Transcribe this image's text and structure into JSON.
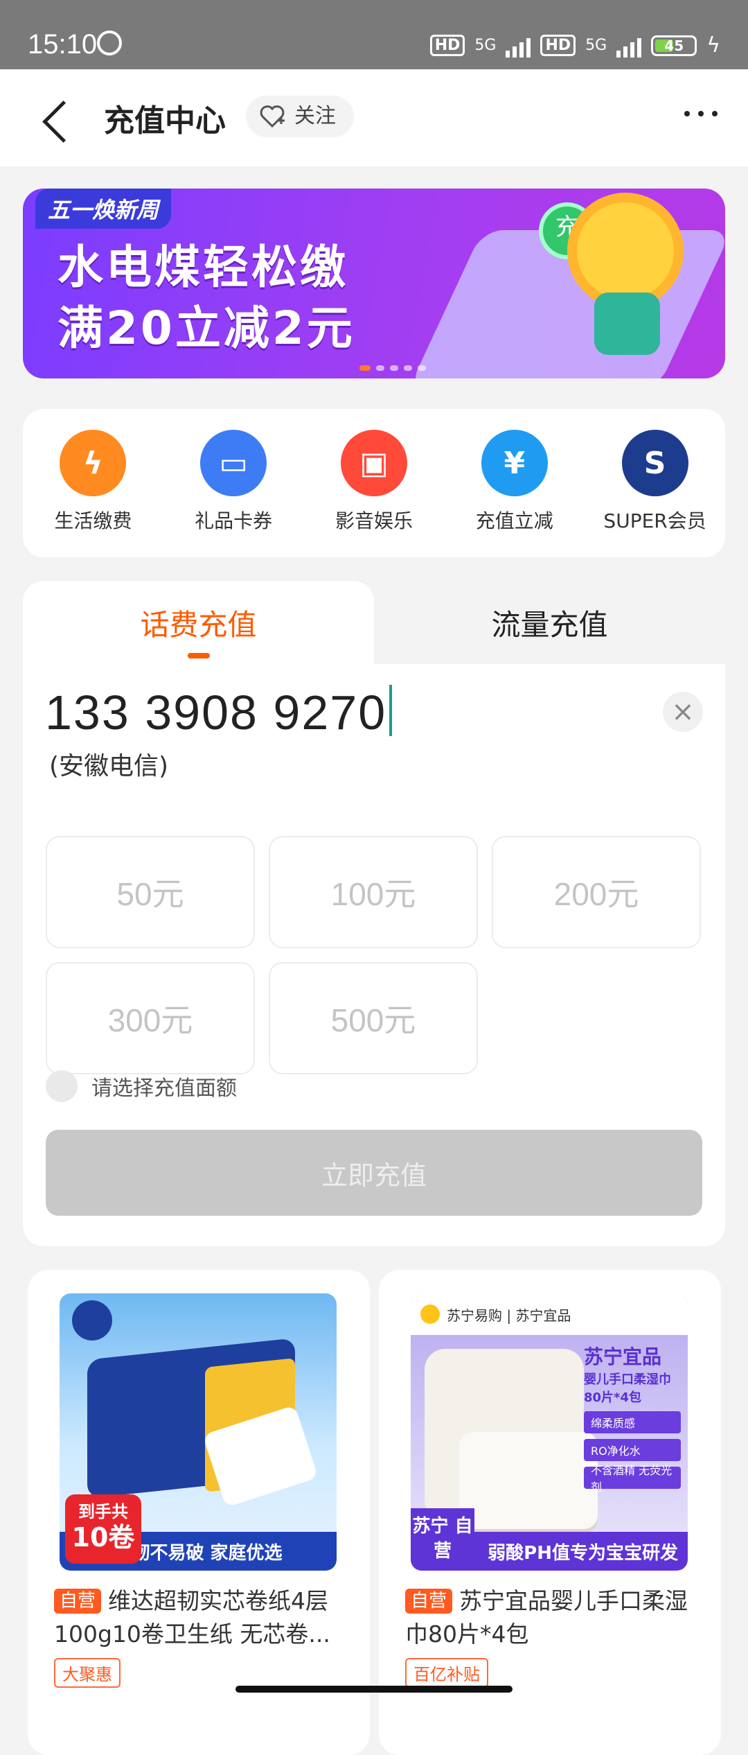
{
  "status_bar": {
    "time": "15:10",
    "network1": "5G",
    "network2": "5G",
    "hd1": "HD",
    "hd2": "HD",
    "battery": "45"
  },
  "header": {
    "title": "充值中心",
    "follow_label": "关注"
  },
  "banner": {
    "tag": "五一焕新周",
    "line1": "水电煤轻松缴",
    "line2": "满20立减2元",
    "coin_text": "充",
    "active_slide": 1,
    "slide_count": 5
  },
  "categories": [
    {
      "label": "生活缴费",
      "icon": "bolt-icon",
      "glyph": "ϟ",
      "color": "#ff8a1f"
    },
    {
      "label": "礼品卡券",
      "icon": "card-icon",
      "glyph": "▭",
      "color": "#3e7cf5"
    },
    {
      "label": "影音娱乐",
      "icon": "media-icon",
      "glyph": "▣",
      "color": "#ff4a3a"
    },
    {
      "label": "充值立减",
      "icon": "yen-ticket-icon",
      "glyph": "¥",
      "color": "#1f9cf2"
    },
    {
      "label": "SUPER会员",
      "icon": "crown-icon",
      "glyph": "S",
      "color": "#1e3c8e"
    }
  ],
  "recharge": {
    "tabs": [
      {
        "label": "话费充值",
        "active": true
      },
      {
        "label": "流量充值",
        "active": false
      }
    ],
    "phone_number": "133 3908 9270",
    "carrier": "(安徽电信)",
    "amounts": [
      "50元",
      "100元",
      "200元",
      "300元",
      "500元"
    ],
    "hint": "请选择充值面额",
    "submit_label": "立即充值"
  },
  "products": [
    {
      "tag": "自营",
      "title": "维达超韧实芯卷纸4层100g10卷卫生纸 无芯卷...",
      "promo": "大聚惠",
      "badge_top": "到手共",
      "badge_main": "10卷",
      "strip_text": "超韧不易破 家庭优选"
    },
    {
      "tag": "自营",
      "title": "苏宁宜品婴儿手口柔湿巾80片*4包",
      "promo": "百亿补贴",
      "brand": "苏宁易购 | 苏宁宜品",
      "name": "苏宁宜品",
      "sub": "婴儿手口柔湿巾 80片*4包",
      "pills": [
        "绵柔质感",
        "RO净化水",
        "不含酒精 无荧光剂"
      ],
      "corner": "苏宁 自营",
      "strip_text": "弱酸PH值专为宝宝研发"
    }
  ]
}
